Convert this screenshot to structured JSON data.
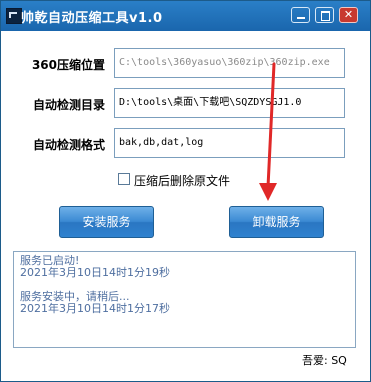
{
  "window": {
    "title": "帅乾自动压缩工具v1.0",
    "controls": [
      "minimize",
      "maximize",
      "close"
    ]
  },
  "form": {
    "rows": [
      {
        "label": "360压缩位置",
        "value": "C:\\tools\\360yasuo\\360zip\\360zip.exe",
        "disabled": true
      },
      {
        "label": "自动检测目录",
        "value": "D:\\tools\\桌面\\下载吧\\SQZDYSGJ1.0",
        "disabled": false
      },
      {
        "label": "自动检测格式",
        "value": "bak,db,dat,log",
        "disabled": false
      }
    ],
    "checkbox": {
      "label": "压缩后删除原文件",
      "checked": false
    }
  },
  "buttons": {
    "install": "安装服务",
    "uninstall": "卸载服务"
  },
  "log": {
    "lines": [
      "服务已启动!",
      "2021年3月10日14时1分19秒",
      "",
      "服务安装中，请稍后...",
      "2021年3月10日14时1分17秒"
    ]
  },
  "status": {
    "text": "吾爱: SQ"
  },
  "colors": {
    "titlebar": "#1a66ad",
    "button": "#3b8ad3",
    "log_text": "#4f6fa0",
    "annotation_arrow": "#e02828"
  }
}
